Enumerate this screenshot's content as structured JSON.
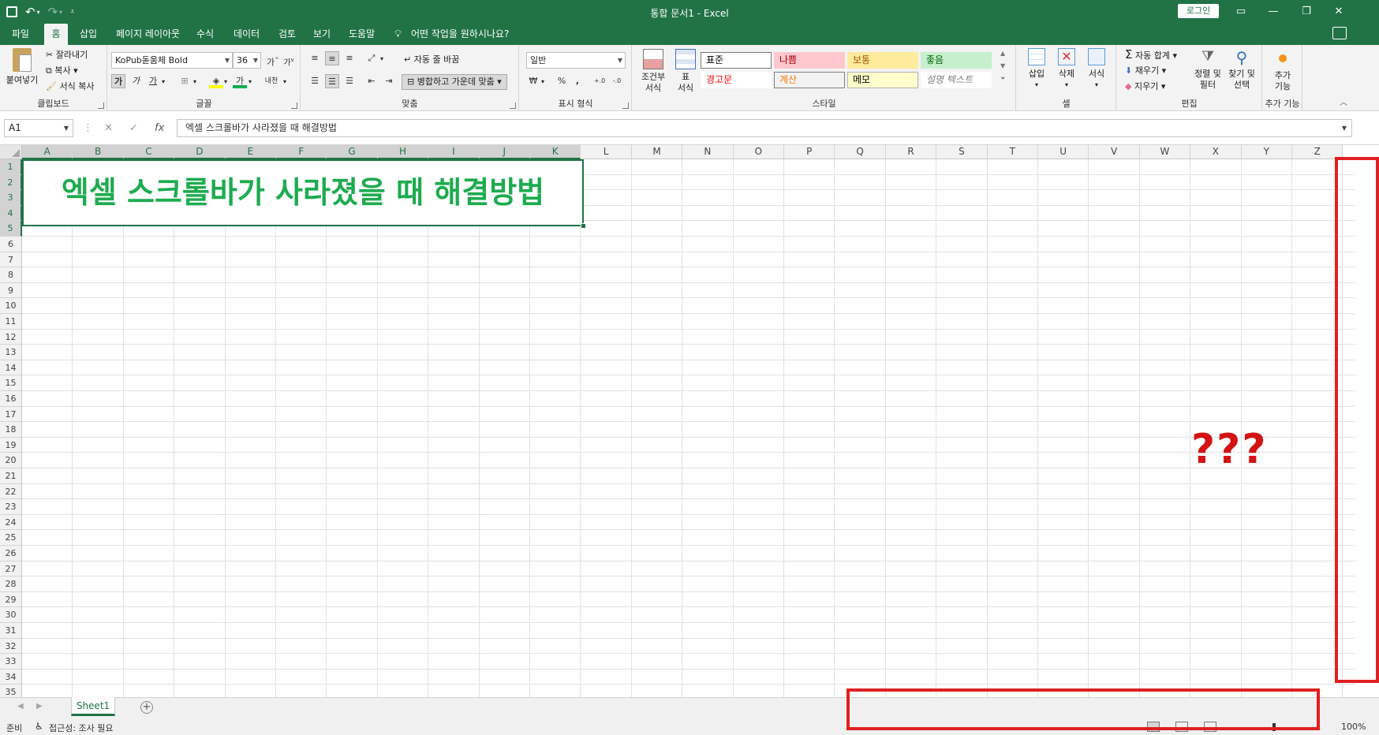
{
  "window": {
    "title": "통합 문서1  -  Excel",
    "login_label": "로그인",
    "controls": [
      "ribbon-display-icon",
      "minimize-icon",
      "restore-icon",
      "close-icon"
    ]
  },
  "qat": {
    "save_icon": "save-icon",
    "undo_icon": "undo-icon",
    "redo_icon": "redo-icon",
    "customize_icon": "customize-qat-icon"
  },
  "tabs": [
    "파일",
    "홈",
    "삽입",
    "페이지 레이아웃",
    "수식",
    "데이터",
    "검토",
    "보기",
    "도움말"
  ],
  "active_tab": "홈",
  "tellme": "어떤 작업을 원하시나요?",
  "ribbon": {
    "clipboard": {
      "label": "클립보드",
      "paste": "붙여넣기",
      "cut": "잘라내기",
      "copy": "복사",
      "format_painter": "서식 복사"
    },
    "font": {
      "label": "글꼴",
      "font_name": "KoPub돋움체 Bold",
      "font_size": "36",
      "grow": "가",
      "shrink": "가",
      "bold": "가",
      "italic": "가",
      "underline": "가",
      "font_color_letter": "가",
      "phonetic": "내천"
    },
    "alignment": {
      "label": "맞춤",
      "wrap_text": "자동 줄 바꿈",
      "merge_center": "병합하고 가운데 맞춤"
    },
    "number": {
      "label": "표시 형식",
      "format": "일반",
      "percent": "%",
      "comma": ",",
      "inc_decimal": "←.0 .00",
      "dec_decimal": ".00 →.0"
    },
    "styles": {
      "label": "스타일",
      "conditional": [
        "조건부",
        "서식"
      ],
      "table": [
        "표",
        "서식"
      ],
      "cells": [
        {
          "name": "표준",
          "bg": "#ffffff",
          "color": "#000000",
          "border": "#7a7a7a"
        },
        {
          "name": "나쁨",
          "bg": "#ffc7ce",
          "color": "#9c0006",
          "border": "#ffc7ce"
        },
        {
          "name": "보통",
          "bg": "#ffeb9c",
          "color": "#9c5700",
          "border": "#ffeb9c"
        },
        {
          "name": "좋음",
          "bg": "#c6efce",
          "color": "#006100",
          "border": "#c6efce"
        },
        {
          "name": "경고문",
          "bg": "#ffffff",
          "color": "#ff0000",
          "border": "#ffffff"
        },
        {
          "name": "계산",
          "bg": "#f2f2f2",
          "color": "#fa7d00",
          "border": "#7f7f7f"
        },
        {
          "name": "메모",
          "bg": "#ffffcc",
          "color": "#000000",
          "border": "#b2b2b2"
        },
        {
          "name": "설명 텍스트",
          "bg": "#ffffff",
          "color": "#7f7f7f",
          "border": "#ffffff"
        }
      ]
    },
    "cells": {
      "label": "셀",
      "insert": "삽입",
      "delete": "삭제",
      "format": "서식"
    },
    "editing": {
      "label": "편집",
      "autosum": "자동 합계",
      "fill": "채우기",
      "clear": "지우기",
      "sort_filter": [
        "정렬 및",
        "필터"
      ],
      "find_select": [
        "찾기 및",
        "선택"
      ]
    },
    "addins": {
      "label": "추가 기능",
      "button": [
        "추가",
        "기능"
      ]
    }
  },
  "formula_bar": {
    "name_box": "A1",
    "cancel": "✕",
    "enter": "✓",
    "fx": "fx",
    "content": "엑셀 스크롤바가 사라졌을 때 해결방법"
  },
  "grid": {
    "columns": [
      "A",
      "B",
      "C",
      "D",
      "E",
      "F",
      "G",
      "H",
      "I",
      "J",
      "K",
      "L",
      "M",
      "N",
      "O",
      "P",
      "Q",
      "R",
      "S",
      "T",
      "U",
      "V",
      "W",
      "X",
      "Y",
      "Z"
    ],
    "rows": [
      "1",
      "2",
      "3",
      "4",
      "5",
      "6",
      "7",
      "8",
      "9",
      "10",
      "11",
      "12",
      "13",
      "14",
      "15",
      "16",
      "17",
      "18",
      "19",
      "20",
      "21",
      "22",
      "23",
      "24",
      "25",
      "26",
      "27",
      "28",
      "29",
      "30",
      "31",
      "32",
      "33",
      "34",
      "35"
    ],
    "merged_text": "엑셀 스크롤바가 사라졌을 때 해결방법",
    "annotation": "???",
    "merged_color": "#1eab4f",
    "annotation_color": "#d41414"
  },
  "sheets": {
    "tabs": [
      "Sheet1"
    ],
    "active": "Sheet1"
  },
  "status": {
    "ready": "준비",
    "accessibility": "접근성: 조사 필요",
    "zoom": "100%"
  },
  "colors": {
    "excel_green": "#217346",
    "highlight_red": "#e02020"
  }
}
